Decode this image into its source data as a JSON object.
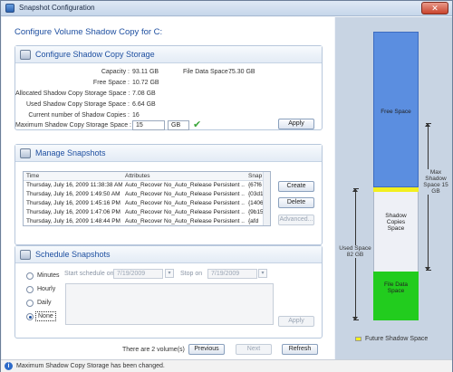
{
  "window": {
    "title": "Snapshot Configuration",
    "close": "✕"
  },
  "heading": "Configure Volume Shadow Copy for C:",
  "storage": {
    "title": "Configure Shadow Copy Storage",
    "capacity_label": "Capacity :",
    "capacity_value": "93.11 GB",
    "file_data_label": "File Data Space :",
    "file_data_value": "75.30 GB",
    "free_label": "Free Space :",
    "free_value": "10.72 GB",
    "alloc_label": "Allocated Shadow Copy Storage Space :",
    "alloc_value": "7.08 GB",
    "used_label": "Used Shadow Copy Storage Space :",
    "used_value": "6.64 GB",
    "count_label": "Current number of Shadow Copies :",
    "count_value": "16",
    "max_label": "Maximum Shadow Copy Storage Space :",
    "max_value": "15",
    "max_unit": "GB",
    "apply": "Apply"
  },
  "manage": {
    "title": "Manage Snapshots",
    "columns": [
      "Time",
      "Attributes",
      "Snap"
    ],
    "rows": [
      [
        "Thursday, July 16, 2009 11:38:38 AM",
        "Auto_Recover No_Auto_Release Persistent ...",
        "{67f6"
      ],
      [
        "Thursday, July 16, 2009 1:49:50 AM",
        "Auto_Recover No_Auto_Release Persistent ...",
        "{03d1"
      ],
      [
        "Thursday, July 16, 2009 1:45:16 PM",
        "Auto_Recover No_Auto_Release Persistent ...",
        "{1406"
      ],
      [
        "Thursday, July 16, 2009 1:47:06 PM",
        "Auto_Recover No_Auto_Release Persistent ...",
        "{9b15"
      ],
      [
        "Thursday, July 16, 2009 1:48:44 PM",
        "Auto_Recover No_Auto_Release Persistent ...",
        "{afd"
      ]
    ],
    "create": "Create",
    "delete": "Delete",
    "advanced": "Advanced..."
  },
  "schedule": {
    "title": "Schedule Snapshots",
    "options": [
      "Minutes",
      "Hourly",
      "Daily",
      "None"
    ],
    "selected": "None",
    "start_label": "Start schedule on",
    "start_date": "7/19/2009",
    "stop_label": "Stop on",
    "stop_date": "7/19/2009",
    "apply": "Apply"
  },
  "footer": {
    "volumes_text": "There are 2 volume(s)",
    "previous": "Previous",
    "next": "Next",
    "refresh": "Refresh"
  },
  "status": {
    "message": "Maximum Shadow Copy Storage has been changed."
  },
  "diagram": {
    "free_label": "Free Space",
    "shadow_label": "Shadow Copies Space",
    "file_label": "File Data Space",
    "max_label": "Max Shadow Space 15 GB",
    "used_label": "Used Space 82 GB",
    "future_label": "Future Shadow Space",
    "colors": {
      "free": "#5b8ee0",
      "future": "#f2ef1f",
      "shadow": "#eef0f6",
      "file": "#22cc1e"
    }
  }
}
